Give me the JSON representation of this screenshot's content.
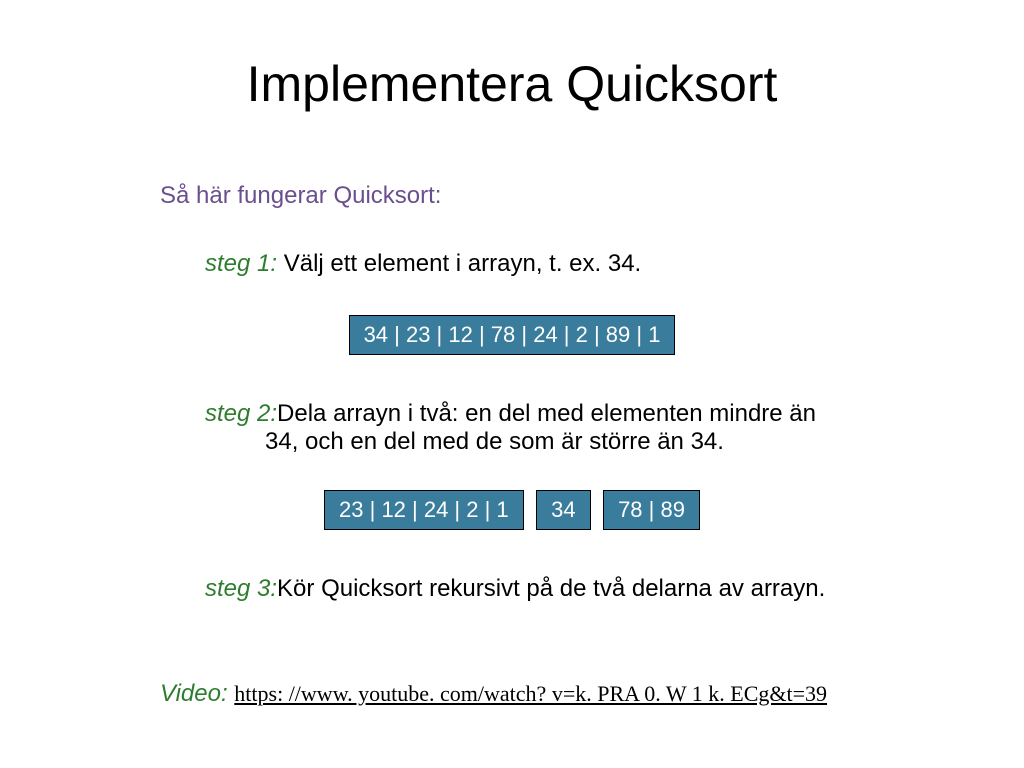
{
  "title": "Implementera Quicksort",
  "subtitle": "Så här fungerar Quicksort:",
  "step1": {
    "label": "steg 1:",
    "text": " Välj ett element i arrayn, t. ex. 34."
  },
  "array1": "34 | 23 | 12 | 78 | 24 | 2 | 89 | 1",
  "step2": {
    "label": "steg 2:",
    "text_a": "Dela arrayn i två: en del med elementen mindre än",
    "text_b": "34, och en del med de som är större än 34."
  },
  "array2_left": "23 | 12 | 24 | 2 | 1",
  "array2_mid": "34",
  "array2_right": "78 | 89",
  "step3": {
    "label": "steg 3:",
    "text": "Kör Quicksort rekursivt på de två delarna av arrayn."
  },
  "video": {
    "label": "Video: ",
    "url": "https: //www. youtube. com/watch? v=k. PRA 0. W 1 k. ECg&t=39"
  }
}
